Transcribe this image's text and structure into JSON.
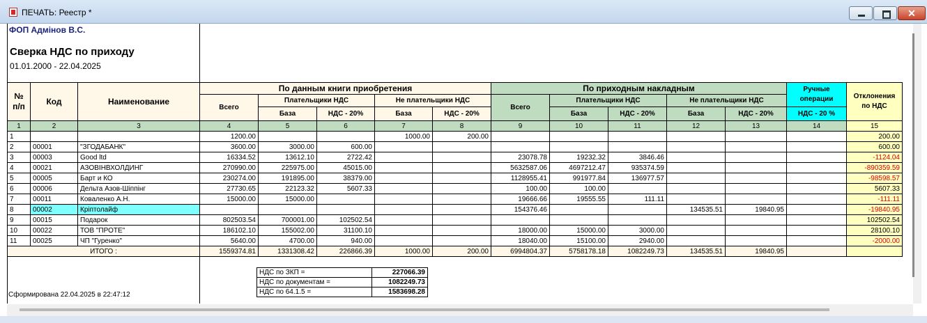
{
  "window": {
    "title": "ПЕЧАТЬ: Реестр  *"
  },
  "header": {
    "company": "ФОП Адмінов В.С.",
    "title": "Сверка НДС по приходу",
    "period": "01.01.2000 - 22.04.2025"
  },
  "columns": {
    "num": "№ п/п",
    "code": "Код",
    "name": "Наименование",
    "book": "По данным книги приобретения",
    "invoices": "По приходным накладным",
    "manual": "Ручные операции",
    "deviation": "Отклонения по НДС",
    "total": "Всего",
    "payers": "Плательщики НДС",
    "nonpayers": "Не плательщики НДС",
    "base": "База",
    "vat20": "НДС - 20%",
    "vat20manual": "НДС - 20 %"
  },
  "column_numbers": [
    "1",
    "2",
    "3",
    "4",
    "5",
    "6",
    "7",
    "8",
    "9",
    "10",
    "11",
    "12",
    "13",
    "14",
    "15"
  ],
  "rows": [
    [
      "1",
      "",
      "",
      "1200.00",
      "",
      "",
      "1000.00",
      "200.00",
      "",
      "",
      "",
      "",
      "",
      "",
      "200.00"
    ],
    [
      "2",
      "00001",
      "\"ЗГОДАБАНК\"",
      "3600.00",
      "3000.00",
      "600.00",
      "",
      "",
      "",
      "",
      "",
      "",
      "",
      "",
      "600.00"
    ],
    [
      "3",
      "00003",
      "Good ltd",
      "16334.52",
      "13612.10",
      "2722.42",
      "",
      "",
      "23078.78",
      "19232.32",
      "3846.46",
      "",
      "",
      "",
      "-1124.04"
    ],
    [
      "4",
      "00021",
      "АЗОВІНВХОЛДИНГ",
      "270990.00",
      "225975.00",
      "45015.00",
      "",
      "",
      "5632587.06",
      "4697212.47",
      "935374.59",
      "",
      "",
      "",
      "-890359.59"
    ],
    [
      "5",
      "00005",
      "Барт и КО",
      "230274.00",
      "191895.00",
      "38379.00",
      "",
      "",
      "1128955.41",
      "991977.84",
      "136977.57",
      "",
      "",
      "",
      "-98598.57"
    ],
    [
      "6",
      "00006",
      "Дельта Азов-Шіппінг",
      "27730.65",
      "22123.32",
      "5607.33",
      "",
      "",
      "100.00",
      "100.00",
      "",
      "",
      "",
      "",
      "5607.33"
    ],
    [
      "7",
      "00011",
      "Коваленко А.Н.",
      "15000.00",
      "15000.00",
      "",
      "",
      "",
      "19666.66",
      "19555.55",
      "111.11",
      "",
      "",
      "",
      "-111.11"
    ],
    [
      "8",
      "00002",
      "Кріптолайф",
      "",
      "",
      "",
      "",
      "",
      "154376.46",
      "",
      "",
      "134535.51",
      "19840.95",
      "",
      "-19840.95"
    ],
    [
      "9",
      "00015",
      "Подарок",
      "802503.54",
      "700001.00",
      "102502.54",
      "",
      "",
      "",
      "",
      "",
      "",
      "",
      "",
      "102502.54"
    ],
    [
      "10",
      "00022",
      "ТОВ \"ПРОТЕ\"",
      "186102.10",
      "155002.00",
      "31100.10",
      "",
      "",
      "18000.00",
      "15000.00",
      "3000.00",
      "",
      "",
      "",
      "28100.10"
    ],
    [
      "11",
      "00025",
      "ЧП \"Гуренко\"",
      "5640.00",
      "4700.00",
      "940.00",
      "",
      "",
      "18040.00",
      "15100.00",
      "2940.00",
      "",
      "",
      "",
      "-2000.00"
    ]
  ],
  "totals": {
    "label": "ИТОГО :",
    "values": [
      "1559374.81",
      "1331308.42",
      "226866.39",
      "1000.00",
      "200.00",
      "6994804.37",
      "5758178.18",
      "1082249.73",
      "134535.51",
      "19840.95",
      "",
      ""
    ]
  },
  "summary": [
    {
      "label": "НДС по ЗКП =",
      "value": "227066.39"
    },
    {
      "label": "НДС по документам =",
      "value": "1082249.73"
    },
    {
      "label": "НДС по 64.1.5 =",
      "value": "1583698.28"
    }
  ],
  "footer": {
    "generated": "Сформирована 22.04.2025 в 22:47:12"
  }
}
